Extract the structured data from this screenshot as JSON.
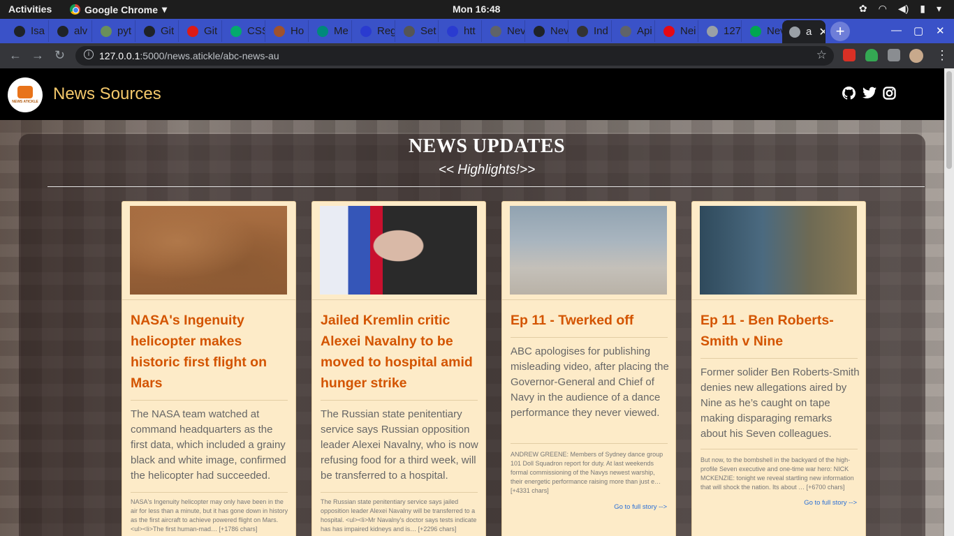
{
  "os_bar": {
    "activities": "Activities",
    "app_name": "Google Chrome",
    "app_menu_caret": "▾",
    "clock": "Mon 16:48",
    "tray": [
      "settings-icon",
      "wifi-icon",
      "volume-icon",
      "battery-icon",
      "menu-caret-icon"
    ]
  },
  "tabs": [
    {
      "label": "Isa",
      "icon": "github-icon",
      "color": "#1f2328"
    },
    {
      "label": "alv",
      "icon": "github-icon",
      "color": "#1f2328"
    },
    {
      "label": "pyt",
      "icon": "python-icon",
      "color": "#6a8f5a"
    },
    {
      "label": "Git",
      "icon": "github-icon",
      "color": "#1f2328"
    },
    {
      "label": "Git",
      "icon": "angular-icon",
      "color": "#dd1b16"
    },
    {
      "label": "CSS",
      "icon": "w3schools-icon",
      "color": "#04aa6d"
    },
    {
      "label": "Ho",
      "icon": "page-icon",
      "color": "#a0522d"
    },
    {
      "label": "Me",
      "icon": "meet-icon",
      "color": "#00897b"
    },
    {
      "label": "Reg",
      "icon": "page-icon",
      "color": "#2a3bd0"
    },
    {
      "label": "Set",
      "icon": "gear-icon",
      "color": "#555555"
    },
    {
      "label": "htt",
      "icon": "page-icon",
      "color": "#2a3bd0"
    },
    {
      "label": "Nev",
      "icon": "globe-icon",
      "color": "#5f6368"
    },
    {
      "label": "Nev",
      "icon": "github-icon",
      "color": "#1f2328"
    },
    {
      "label": "Ind",
      "icon": "grid-icon",
      "color": "#333333"
    },
    {
      "label": "Api",
      "icon": "globe-icon",
      "color": "#5f6368"
    },
    {
      "label": "Nei",
      "icon": "netflix-icon",
      "color": "#e50914"
    },
    {
      "label": "127",
      "icon": "loading-icon",
      "color": "#9aa0a6"
    },
    {
      "label": "Nev",
      "icon": "px-icon",
      "color": "#00a650"
    },
    {
      "label": "a",
      "icon": "globe-icon",
      "color": "#9aa0a6"
    }
  ],
  "window_controls": [
    "minimize-icon",
    "maximize-icon",
    "close-icon"
  ],
  "address": {
    "host": "127.0.0.1",
    "path": ":5000/news.atickle/abc-news-au"
  },
  "site": {
    "brand": "News Sources",
    "logo_text": "NEWS ATICKLE",
    "social": [
      "github-icon",
      "twitter-icon",
      "instagram-icon"
    ],
    "heading": "NEWS UPDATES",
    "subheading": "<< Highlights!>>",
    "read_more": "Go to full story -->"
  },
  "articles": [
    {
      "image": "mars-helicopter-image",
      "title": "NASA's Ingenuity helicopter makes historic first flight on Mars",
      "description": "The NASA team watched at command headquarters as the first data, which included a grainy black and white image, confirmed the helicopter had succeeded.",
      "content": "NASA's Ingenuity helicopter may only have been in the air for less than a minute, but it has gone down in history as the first aircraft to achieve powered flight on Mars. <ul><li>The first human-mad… [+1786 chars]"
    },
    {
      "image": "navalny-portrait-image",
      "title": "Jailed Kremlin critic Alexei Navalny to be moved to hospital amid hunger strike",
      "description": "The Russian state penitentiary service says Russian opposition leader Alexei Navalny, who is now refusing food for a third week, will be transferred to a hospital.",
      "content": "The Russian state penitentiary service says jailed opposition leader Alexei Navalny will be transferred to a hospital. <ul><li>Mr Navalny's doctor says tests indicate has has impaired kidneys and is… [+2296 chars]"
    },
    {
      "image": "dance-performance-image",
      "title": "Ep 11 - Twerked off",
      "description": "ABC apologises for publishing misleading video, after placing the Governor-General and Chief of Navy in the audience of a dance performance they never viewed.",
      "content": "ANDREW GREENE: Members of Sydney dance group 101 Doll Squadron report for duty. At last weekends formal commissioning of the Navys newest warship, their energetic performance raising more than just e… [+4331 chars]"
    },
    {
      "image": "secrets-of-war-image",
      "title": "Ep 11 - Ben Roberts-Smith v Nine",
      "description": "Former solider Ben Roberts-Smith denies new allegations aired by Nine as he’s caught on tape making disparaging remarks about his Seven colleagues.",
      "content": "But now, to the bombshell in the backyard of the high-profile Seven executive and one-time war hero: NICK MCKENZIE: tonight we reveal startling new information that will shock the nation. Its about … [+6700 chars]"
    }
  ]
}
